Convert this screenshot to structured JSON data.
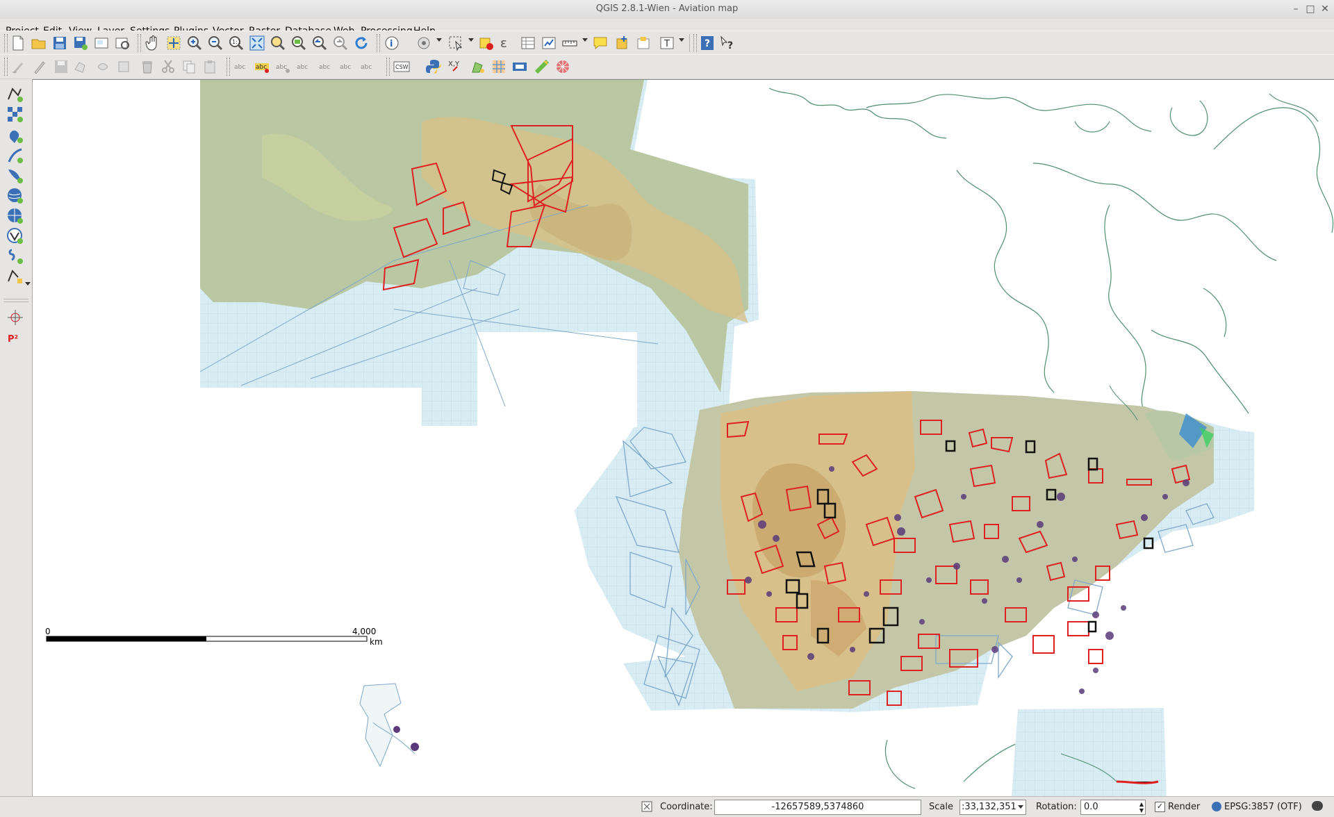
{
  "window": {
    "title": "QGIS 2.8.1-Wien - Aviation map"
  },
  "menu": [
    {
      "label": "Project",
      "hotkey": "P"
    },
    {
      "label": "Edit",
      "hotkey": "E"
    },
    {
      "label": "View",
      "hotkey": "V"
    },
    {
      "label": "Layer",
      "hotkey": "L"
    },
    {
      "label": "Settings",
      "hotkey": "S"
    },
    {
      "label": "Plugins",
      "hotkey": "P"
    },
    {
      "label": "Vector",
      "hotkey": "o"
    },
    {
      "label": "Raster",
      "hotkey": "R"
    },
    {
      "label": "Database",
      "hotkey": "D"
    },
    {
      "label": "Web",
      "hotkey": "W"
    },
    {
      "label": "Processing",
      "hotkey": "c"
    },
    {
      "label": "Help",
      "hotkey": "H"
    }
  ],
  "toolbar1": [
    "new-project",
    "open-project",
    "save-project",
    "save-as",
    "new-print-composer",
    "composer-manager",
    "pan-map",
    "pan-to-selection",
    "zoom-in",
    "zoom-out",
    "zoom-actual",
    "zoom-full",
    "zoom-to-selection",
    "zoom-to-layer",
    "zoom-last",
    "zoom-next",
    "refresh",
    "identify",
    "run-feature-action",
    "select-features",
    "deselect-all",
    "expression-select",
    "attribute-table",
    "statistics",
    "measure",
    "map-tips",
    "new-bookmark",
    "show-bookmarks",
    "text-annotation",
    "help-contents",
    "whats-this"
  ],
  "toolbar2": [
    "current-edits",
    "toggle-editing",
    "save-layer-edits",
    "add-feature",
    "move-feature",
    "delete-selected",
    "cut-features",
    "copy-features",
    "paste-features",
    "label-tool",
    "pin-labels",
    "highlight-pinned",
    "move-label",
    "rotate-label",
    "change-label",
    "show-hide-labels",
    "csw-client",
    "python-console",
    "xy-tool",
    "geometry-checker",
    "raster-calculator",
    "print-composer",
    "georeferencer",
    "grid-tool"
  ],
  "toolbar2_text": {
    "csw": "CSW",
    "xy": "X,Y"
  },
  "sidebar_tools": [
    "add-vector-layer",
    "add-raster-layer",
    "add-postgis-layer",
    "add-spatialite-layer",
    "add-mssql-layer",
    "add-wms-layer",
    "add-wcs-layer",
    "add-wfs-layer",
    "add-delimited-text-layer",
    "new-shapefile-layer",
    "coordinate-capture",
    "plugin-p2"
  ],
  "sidebar_text": {
    "p2": "P²"
  },
  "map": {
    "scalebar": {
      "start": "0",
      "end": "4,000",
      "unit": "km"
    },
    "colors": {
      "chart_water": "#d8ecf3",
      "terrain_tan": "#d8c08a",
      "terrain_green": "#b9c7a2",
      "airspace_red": "#e02020",
      "airspace_black": "#111111",
      "coastline": "#4f8f6f",
      "airway_blue": "#7fa8c9"
    }
  },
  "status": {
    "coordinate_label": "Coordinate:",
    "coordinate_value": "-12657589,5374860",
    "scale_label": "Scale",
    "scale_value": ":33,132,351",
    "rotation_label": "Rotation:",
    "rotation_value": "0.0",
    "render_label": "Render",
    "render_checked": true,
    "crs_label": "EPSG:3857 (OTF)"
  }
}
